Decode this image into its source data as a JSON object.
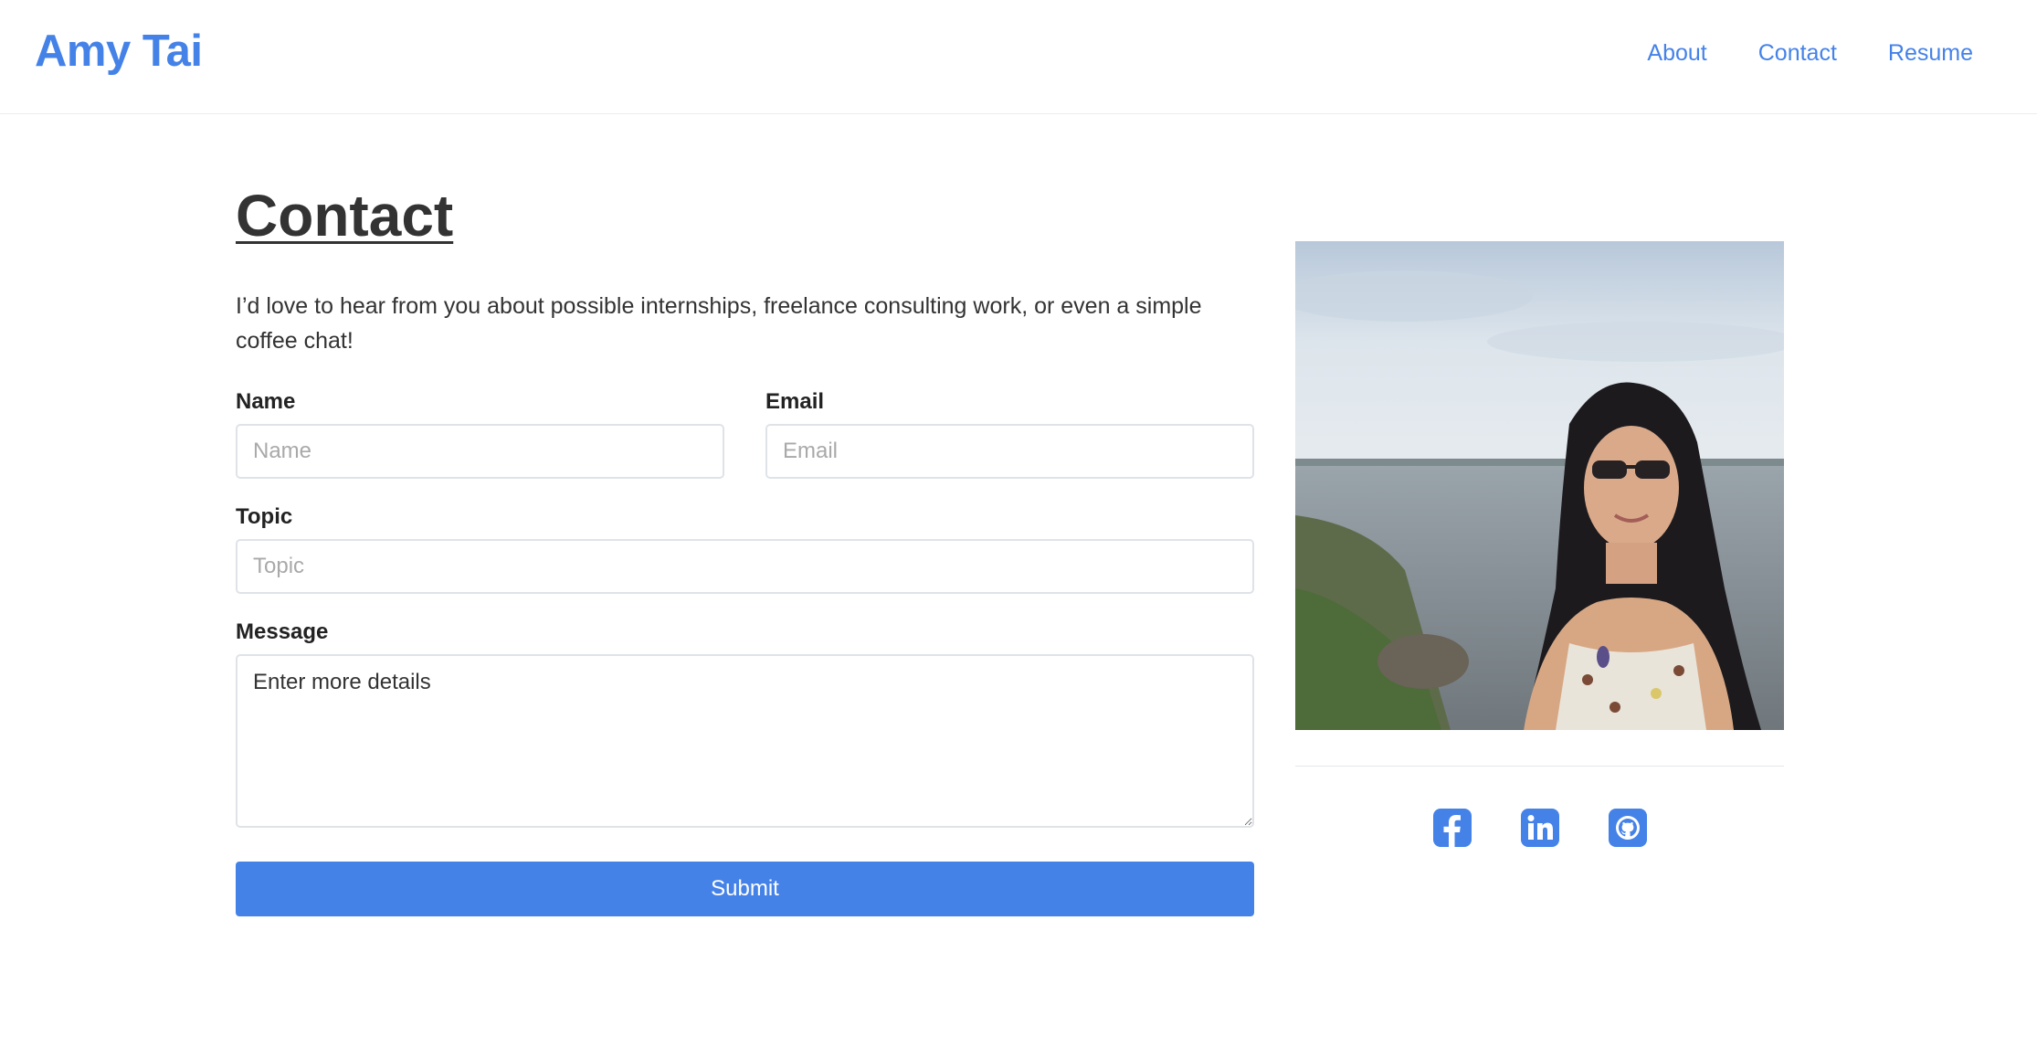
{
  "header": {
    "brand": "Amy Tai",
    "nav": [
      "About",
      "Contact",
      "Resume"
    ]
  },
  "page": {
    "title": "Contact",
    "intro": "I’d love to hear from you about possible internships, freelance consulting work, or even a simple coffee chat!"
  },
  "form": {
    "name": {
      "label": "Name",
      "placeholder": "Name",
      "value": ""
    },
    "email": {
      "label": "Email",
      "placeholder": "Email",
      "value": ""
    },
    "topic": {
      "label": "Topic",
      "placeholder": "Topic",
      "value": ""
    },
    "message": {
      "label": "Message",
      "placeholder": "Enter more details",
      "value": ""
    },
    "submit_label": "Submit"
  },
  "social": [
    {
      "icon": "facebook-icon"
    },
    {
      "icon": "linkedin-icon"
    },
    {
      "icon": "github-icon"
    }
  ],
  "colors": {
    "accent": "#4582e8",
    "text": "#333333"
  }
}
